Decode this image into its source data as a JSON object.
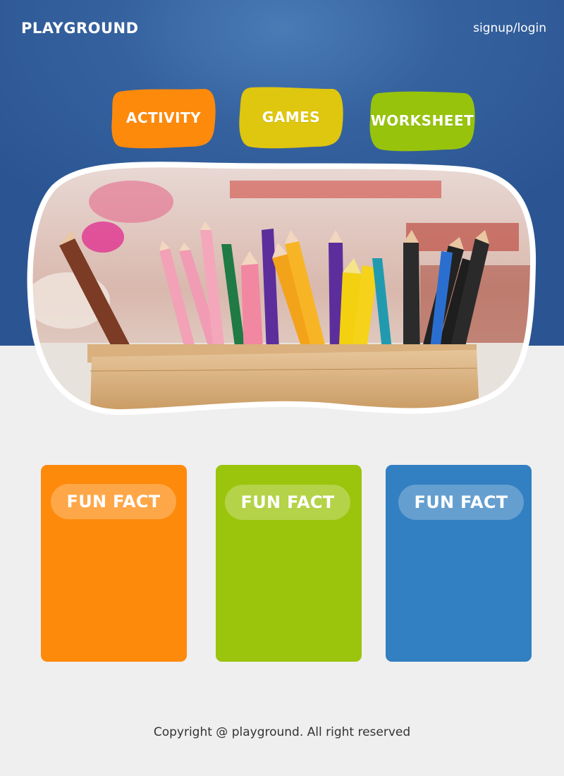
{
  "header": {
    "logo": "PLAYGROUND",
    "login_link": "signup/login"
  },
  "nav": {
    "items": [
      {
        "label": "ACTIVITY",
        "color": "#fe8a0b"
      },
      {
        "label": "GAMES",
        "color": "#dfc60f"
      },
      {
        "label": "WORKSHEET",
        "color": "#97c30c"
      }
    ]
  },
  "hero": {
    "image": "colored-pencils-in-wooden-box"
  },
  "fun_facts": [
    {
      "title": "FUN FACT",
      "color": "#fe8a0b"
    },
    {
      "title": "FUN FACT",
      "color": "#9bc40c"
    },
    {
      "title": "FUN FACT",
      "color": "#327fc1"
    }
  ],
  "footer": {
    "copyright": "Copyright @ playground. All right reserved"
  },
  "colors": {
    "hero_blue": "#2d5895",
    "page_bg": "#efefef"
  }
}
